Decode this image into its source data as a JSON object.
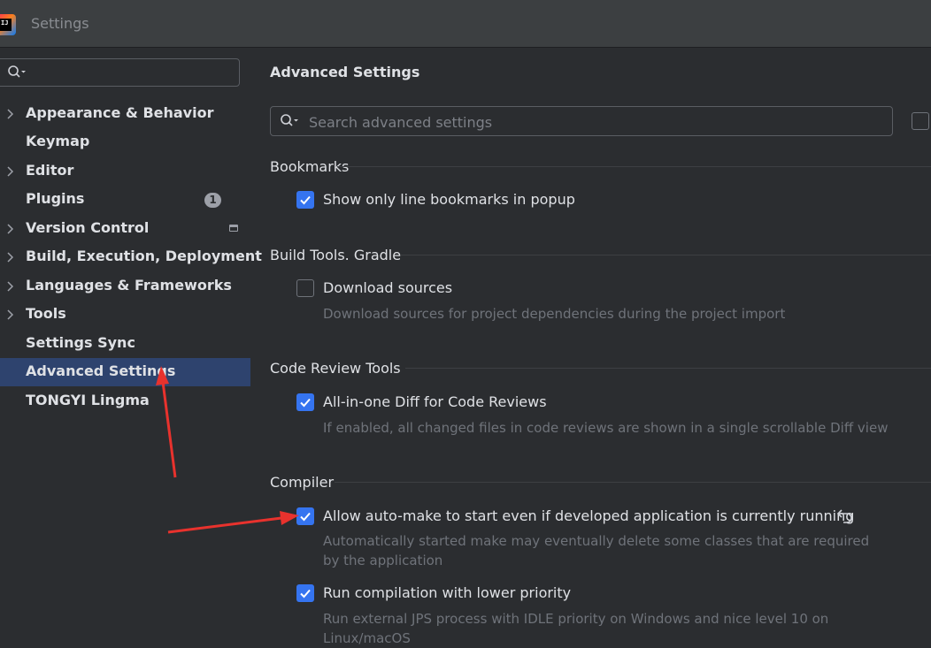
{
  "window": {
    "title": "Settings",
    "logo_text": "IJ"
  },
  "sidebar": {
    "search_placeholder": "",
    "items": [
      {
        "label": "Appearance & Behavior",
        "expandable": true
      },
      {
        "label": "Keymap",
        "expandable": false
      },
      {
        "label": "Editor",
        "expandable": true
      },
      {
        "label": "Plugins",
        "expandable": false,
        "badge": "1"
      },
      {
        "label": "Version Control",
        "expandable": true,
        "icon": "project-level-icon"
      },
      {
        "label": "Build, Execution, Deployment",
        "expandable": true
      },
      {
        "label": "Languages & Frameworks",
        "expandable": true
      },
      {
        "label": "Tools",
        "expandable": true
      },
      {
        "label": "Settings Sync",
        "expandable": false
      },
      {
        "label": "Advanced Settings",
        "expandable": false,
        "selected": true
      },
      {
        "label": "TONGYI Lingma",
        "expandable": false
      }
    ]
  },
  "main": {
    "title": "Advanced Settings",
    "search_placeholder": "Search advanced settings",
    "sections": [
      {
        "title": "Bookmarks",
        "options": [
          {
            "label": "Show only line bookmarks in popup",
            "checked": true,
            "description": ""
          }
        ]
      },
      {
        "title": "Build Tools. Gradle",
        "options": [
          {
            "label": "Download sources",
            "checked": false,
            "description": "Download sources for project dependencies during the project import"
          }
        ]
      },
      {
        "title": "Code Review Tools",
        "options": [
          {
            "label": "All-in-one Diff for Code Reviews",
            "checked": true,
            "description": "If enabled, all changed files in code reviews are shown in a single scrollable Diff view"
          }
        ]
      },
      {
        "title": "Compiler",
        "options": [
          {
            "label": "Allow auto-make to start even if developed application is currently running",
            "checked": true,
            "modified": true,
            "description_line1": "Automatically started make may eventually delete some classes that are required",
            "description_line2": "by the application"
          },
          {
            "label": "Run compilation with lower priority",
            "checked": true,
            "description_line1": "Run external JPS process with IDLE priority on Windows and nice level 10 on",
            "description_line2": "Linux/macOS"
          }
        ]
      }
    ]
  },
  "colors": {
    "background": "#2b2d30",
    "selection": "#2e436e",
    "checkbox_accent": "#3574f0",
    "annotation_arrow": "#e8322d"
  }
}
